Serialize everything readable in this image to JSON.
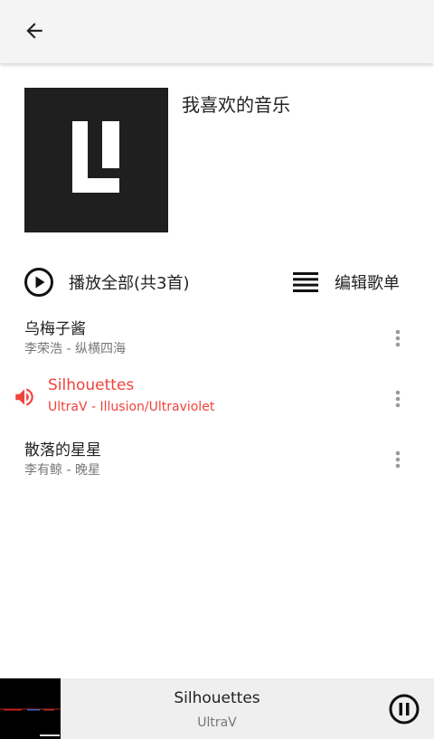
{
  "header": {
    "back_icon": "arrow-left-icon"
  },
  "playlist": {
    "title": "我喜欢的音乐",
    "cover_icon": "album-cover-logo"
  },
  "actions": {
    "play_all_label": "播放全部(共3首)",
    "play_icon": "play-circle-icon",
    "edit_label": "编辑歌单",
    "edit_icon": "list-icon"
  },
  "songs": [
    {
      "title": "乌梅子酱",
      "subtitle": "李荣浩 - 纵横四海",
      "playing": false
    },
    {
      "title": "Silhouettes",
      "subtitle": "UltraV - Illusion/Ultraviolet",
      "playing": true
    },
    {
      "title": "散落的星星",
      "subtitle": "李有鲸 - 晚星",
      "playing": false
    }
  ],
  "player": {
    "title": "Silhouettes",
    "artist": "UltraV",
    "pause_icon": "pause-circle-icon"
  },
  "colors": {
    "accent": "#f0433c",
    "topbar": "#f4f4f4",
    "player_bar": "#efefef"
  }
}
